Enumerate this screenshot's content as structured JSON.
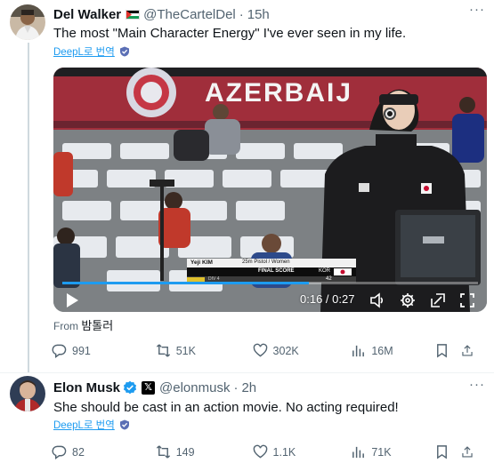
{
  "tweet1": {
    "name": "Del Walker",
    "handle": "@TheCartelDel",
    "separator": "·",
    "time": "15h",
    "more": "···",
    "text": "The most \"Main Character Energy\" I've ever seen in my life.",
    "translate_label": "DeepL로 번역",
    "video": {
      "banner_text": "AZERBAIJ",
      "caption_name": "Yeji KIM",
      "caption_event": "25m Pistol / Women",
      "caption_score_label": "FINAL SCORE",
      "caption_country": "KOR",
      "caption_score": "42",
      "caption_sub": "DIV 4",
      "timecode": "0:16 / 0:27",
      "progress": 0.5926
    },
    "from_label": "From",
    "from_source": "밤톨러",
    "actions": {
      "replies": "991",
      "reposts": "51K",
      "likes": "302K",
      "views": "16M"
    }
  },
  "tweet2": {
    "name": "Elon Musk",
    "handle": "@elonmusk",
    "separator": "·",
    "time": "2h",
    "more": "···",
    "text": "She should be cast in an action movie. No  acting required!",
    "translate_label": "DeepL로 번역",
    "actions": {
      "replies": "82",
      "reposts": "149",
      "likes": "1.1K",
      "views": "71K"
    }
  },
  "colors": {
    "accent": "#1d9bf0",
    "text_primary": "#0f1419",
    "text_secondary": "#536471",
    "divider": "#eff3f4",
    "verified": "#1d9bf0"
  },
  "icons": {
    "reply": "reply-icon",
    "repost": "repost-icon",
    "like": "heart-icon",
    "views": "views-icon",
    "share": "share-icon",
    "bookmark": "bookmark-icon",
    "play": "play-icon",
    "volume": "volume-icon",
    "settings": "gear-icon",
    "pip": "picture-in-picture-icon",
    "fullscreen": "fullscreen-icon"
  }
}
